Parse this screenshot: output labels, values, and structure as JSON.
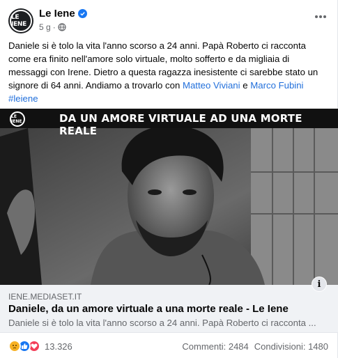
{
  "header": {
    "avatar_text": "LE IENE",
    "page_name": "Le Iene",
    "time": "5 g",
    "separator": "·",
    "more_icon": "more-icon"
  },
  "post": {
    "text_main": "Daniele si è tolo la vita l'anno scorso a 24 anni. Papà Roberto ci racconta come era finito nell'amore solo virtuale, molto sofferto e da migliaia di messaggi con Irene. Dietro a questa ragazza inesistente ci sarebbe stato un signore di 64 anni. Andiamo a trovarlo con ",
    "mention_1": "Matteo Viviani",
    "connector": "e",
    "mention_2": "Marco Fubini",
    "hashtag": "#leiene"
  },
  "media": {
    "logo_text": "LE IENE",
    "banner_title": "DA UN AMORE VIRTUALE AD UNA MORTE REALE"
  },
  "link_preview": {
    "domain": "IENE.MEDIASET.IT",
    "title": "Daniele, da un amore virtuale a una morte reale - Le Iene",
    "description": "Daniele si è tolo la vita l'anno scorso a 24 anni. Papà Roberto ci racconta ...",
    "info_label": "i"
  },
  "footer": {
    "reactions": [
      "sad",
      "like",
      "love"
    ],
    "reaction_count": "13.326",
    "comments": "Commenti: 2484",
    "shares": "Condivisioni: 1480"
  },
  "colors": {
    "link": "#216fdb",
    "verified": "#1877f2",
    "secondary_text": "#65676b"
  }
}
